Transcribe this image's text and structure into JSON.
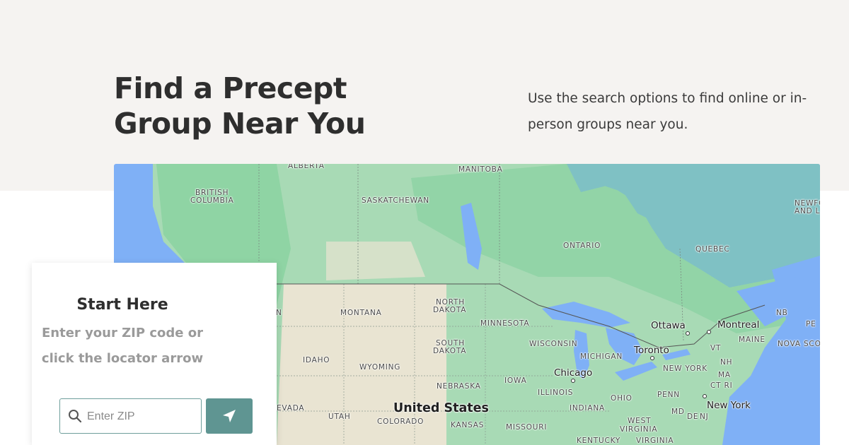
{
  "header": {
    "title_line1": "Find a Precept",
    "title_line2": "Group Near You",
    "intro": "Use the search options to find online or in-person groups near you."
  },
  "map": {
    "labels": {
      "alberta": "ALBERTA",
      "manitoba": "MANITOBA",
      "british_columbia_1": "BRITISH",
      "british_columbia_2": "COLUMBIA",
      "saskatchewan": "SASKATCHEWAN",
      "ontario": "ONTARIO",
      "quebec": "QUEBEC",
      "newfoundland_1": "NEWFO",
      "newfoundland_2": "AND L",
      "montana": "MONTANA",
      "north_dakota_1": "NORTH",
      "north_dakota_2": "DAKOTA",
      "minnesota": "MINNESOTA",
      "south_dakota_1": "SOUTH",
      "south_dakota_2": "DAKOTA",
      "wisconsin": "WISCONSIN",
      "michigan": "MICHIGAN",
      "idaho": "IDAHO",
      "wyoming": "WYOMING",
      "iowa": "IOWA",
      "nebraska": "NEBRASKA",
      "illinois": "ILLINOIS",
      "ohio": "OHIO",
      "penn": "PENN",
      "new_york_state": "NEW YORK",
      "vt": "VT",
      "nh": "NH",
      "ma": "MA",
      "ct_ri": "CT RI",
      "nj": "NJ",
      "md": "MD",
      "de": "DE",
      "nb": "NB",
      "pe": "PE",
      "nova_scotia": "NOVA SCO",
      "maine": "MAINE",
      "nevada": "EVADA",
      "utah": "UTAH",
      "colorado": "COLORADO",
      "kansas": "KANSAS",
      "missouri": "MISSOURI",
      "indiana": "INDIANA",
      "west_virginia_1": "WEST",
      "west_virginia_2": "VIRGINIA",
      "kentucky": "KENTUCKY",
      "virginia": "VIRGINIA",
      "n_edge": "N",
      "united_states": "United States",
      "ottawa": "Ottawa",
      "montreal": "Montreal",
      "toronto": "Toronto",
      "chicago": "Chicago",
      "new_york_city": "New York"
    }
  },
  "start": {
    "title": "Start Here",
    "subtitle_line1": "Enter your ZIP code or",
    "subtitle_line2": "click the locator arrow",
    "zip_placeholder": "Enter ZIP"
  },
  "colors": {
    "accent": "#5f9592",
    "water": "#7fb0f6",
    "land_green": "#a8dab5"
  },
  "icons": {
    "search": "search-icon",
    "locator": "navigation-arrow-icon"
  }
}
